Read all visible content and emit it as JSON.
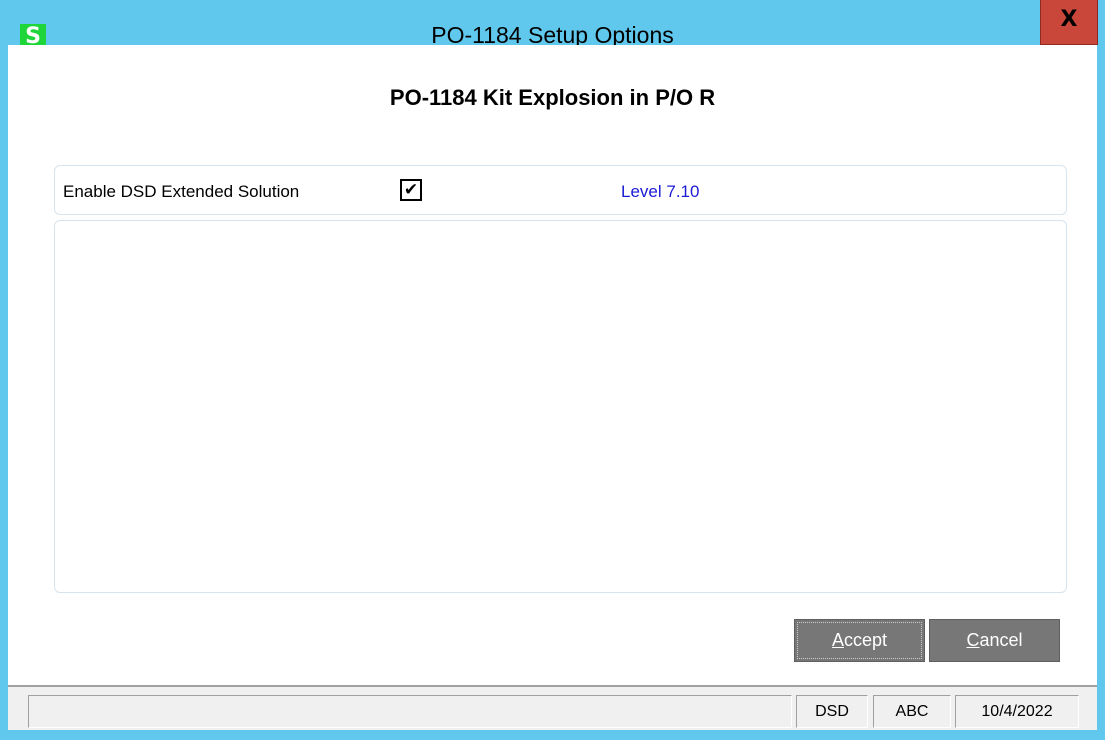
{
  "window": {
    "title": "PO-1184 Setup Options",
    "app_icon": "S",
    "close_glyph": "X"
  },
  "main": {
    "heading": "PO-1184 Kit Explosion in P/O R",
    "option": {
      "label": "Enable DSD Extended Solution",
      "checked": true,
      "check_glyph": "✔",
      "level": "Level  7.10"
    }
  },
  "buttons": {
    "accept_first": "A",
    "accept_rest": "ccept",
    "cancel_first": "C",
    "cancel_rest": "ancel"
  },
  "statusbar": {
    "message": "",
    "company_code": "DSD",
    "company": "ABC",
    "date": "10/4/2022"
  },
  "colors": {
    "title_bar": "#60c8ec",
    "close_button": "#c8473a",
    "app_icon": "#1fd63a",
    "level_text": "#1b1bd6",
    "button_bg": "#777777"
  }
}
